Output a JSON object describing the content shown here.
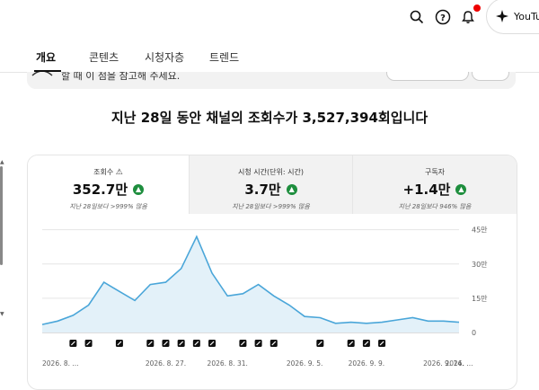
{
  "topbar": {
    "search_icon": "search-icon",
    "help_icon": "help-icon",
    "notifications_icon": "bell-icon",
    "youtube_button_label": "YouTube"
  },
  "tabs": [
    {
      "label": "개요",
      "active": true
    },
    {
      "label": "콘텐츠",
      "active": false
    },
    {
      "label": "시청자층",
      "active": false
    },
    {
      "label": "트렌드",
      "active": false
    }
  ],
  "banner": {
    "text": "할 때 이 점을 참고해 주세요."
  },
  "headline": "지난 28일 동안 채널의 조회수가 3,527,394회입니다",
  "metrics": [
    {
      "label": "조회수",
      "value": "352.7만",
      "comparison": "지난 28일보다 >999% 많음",
      "trend": "up",
      "warning": true
    },
    {
      "label": "시청 시간(단위: 시간)",
      "value": "3.7만",
      "comparison": "지난 28일보다 >999% 많음",
      "trend": "up",
      "warning": false
    },
    {
      "label": "구독자",
      "value": "+1.4만",
      "comparison": "지난 28일보다 946% 많음",
      "trend": "up",
      "warning": false
    }
  ],
  "colors": {
    "accent_line": "#4aa6d9",
    "area_fill": "#e3f1f9",
    "up_badge": "#1e8e3e",
    "grid": "#e5e5e5"
  },
  "chart_data": {
    "type": "area",
    "x": [
      "2026. 8. 19.",
      "2026. 8. 20.",
      "2026. 8. 21.",
      "2026. 8. 22.",
      "2026. 8. 23.",
      "2026. 8. 24.",
      "2026. 8. 25.",
      "2026. 8. 26.",
      "2026. 8. 27.",
      "2026. 8. 28.",
      "2026. 8. 29.",
      "2026. 8. 30.",
      "2026. 8. 31.",
      "2026. 9. 1.",
      "2026. 9. 2.",
      "2026. 9. 3.",
      "2026. 9. 4.",
      "2026. 9. 5.",
      "2026. 9. 6.",
      "2026. 9. 7.",
      "2026. 9. 8.",
      "2026. 9. 9.",
      "2026. 9. 10.",
      "2026. 9. 11.",
      "2026. 9. 12.",
      "2026. 9. 13.",
      "2026. 9. 14.",
      "2026. 9. 15."
    ],
    "values": [
      3.5,
      5,
      7.5,
      12,
      22,
      18,
      14,
      21,
      22,
      28,
      42,
      26,
      16,
      17,
      21,
      16,
      12,
      7,
      6.5,
      4,
      4.5,
      4,
      4.5,
      5.5,
      6.5,
      5,
      5,
      4.5
    ],
    "yticks": [
      "45만",
      "30만",
      "15만",
      "0"
    ],
    "ytick_values": [
      45,
      30,
      15,
      0
    ],
    "ylim": [
      0,
      48
    ],
    "xtick_labels": [
      "2026. 8. ...",
      "2026. 8. 27.",
      "2026. 8. 31.",
      "2026. 9. 5.",
      "2026. 9. 9.",
      "2026. 9. 14.",
      "2026. ..."
    ],
    "xtick_indices": [
      0,
      8,
      12,
      17,
      21,
      26,
      27
    ],
    "video_marker_indices": [
      2,
      3,
      5,
      7,
      8,
      9,
      10,
      11,
      13,
      14,
      15,
      18,
      20,
      21,
      22
    ],
    "grid": true,
    "legend": "none"
  }
}
